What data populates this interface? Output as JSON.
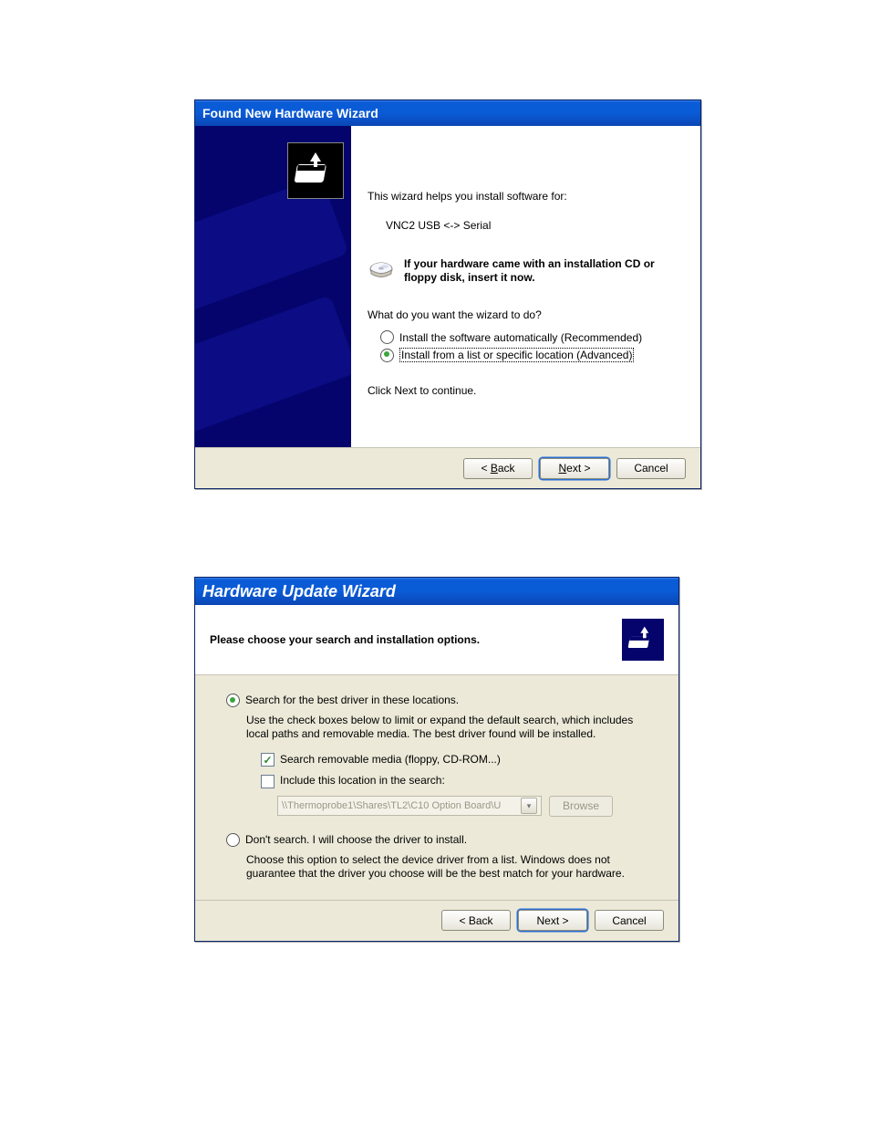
{
  "dialog1": {
    "title": "Found New Hardware Wizard",
    "intro": "This wizard helps you install software for:",
    "device_name": "VNC2 USB <-> Serial",
    "cd_hint": "If your hardware came with an installation CD or floppy disk, insert it now.",
    "prompt": "What do you want the wizard to do?",
    "option_auto": "Install the software automatically (Recommended)",
    "option_advanced": "Install from a list or specific location (Advanced)",
    "selected": "advanced",
    "continue_text": "Click Next to continue.",
    "buttons": {
      "back": "< Back",
      "next": "Next >",
      "cancel": "Cancel"
    }
  },
  "dialog2": {
    "title": "Hardware Update Wizard",
    "subtitle": "Please choose your search and installation options.",
    "opt_search": {
      "label": "Search for the best driver in these locations.",
      "selected": true,
      "desc": "Use the check boxes below to limit or expand the default search, which includes local paths and removable media. The best driver found will be installed.",
      "check_removable": {
        "label": "Search removable media (floppy, CD-ROM...)",
        "checked": true
      },
      "check_include": {
        "label": "Include this location in the search:",
        "checked": false
      },
      "path_value": "\\\\Thermoprobe1\\Shares\\TL2\\C10 Option Board\\U",
      "browse_label": "Browse"
    },
    "opt_dont": {
      "label": "Don't search. I will choose the driver to install.",
      "selected": false,
      "desc": "Choose this option to select the device driver from a list.  Windows does not guarantee that the driver you choose will be the best match for your hardware."
    },
    "buttons": {
      "back": "< Back",
      "next": "Next >",
      "cancel": "Cancel"
    }
  }
}
